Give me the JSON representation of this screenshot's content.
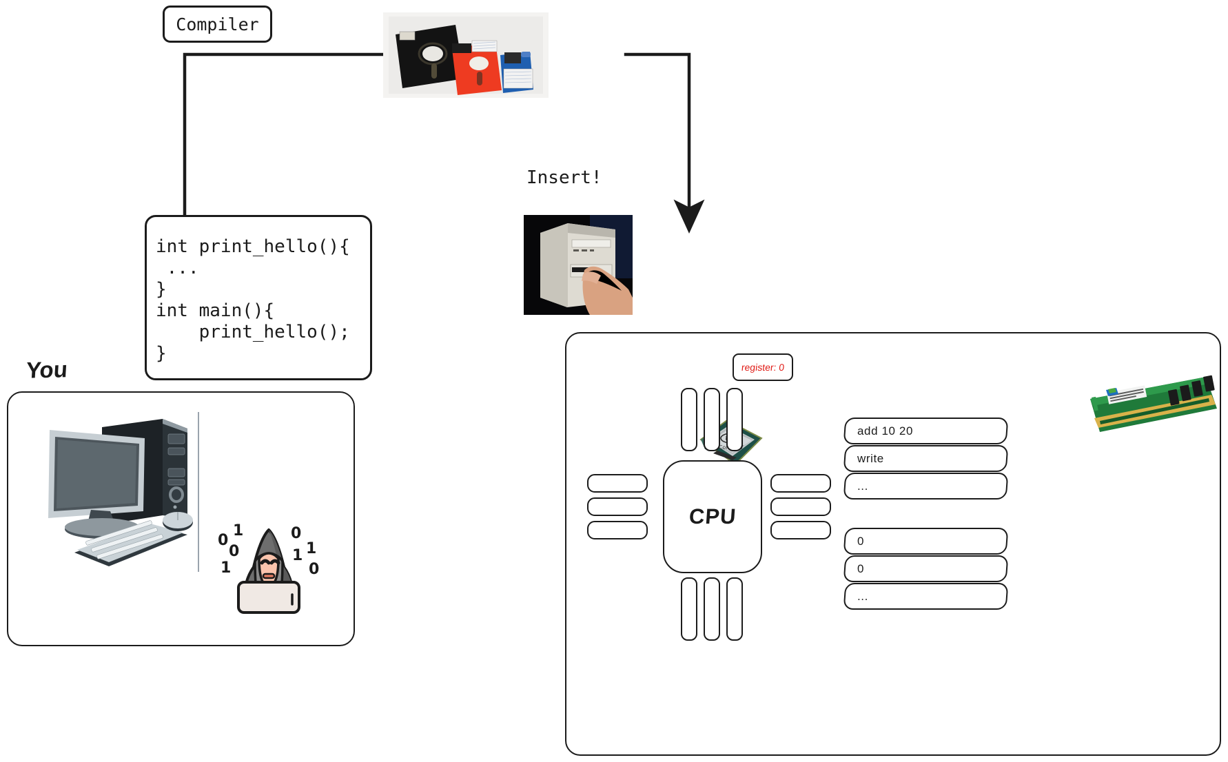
{
  "diagram": {
    "title": "Compiler, floppy disk, computer and CPU diagram",
    "compiler_label": "Compiler",
    "insert_label": "Insert!",
    "you_label": "You",
    "cpu_label": "CPU",
    "register_label": "register: 0",
    "code_lines": [
      "int print_hello(){",
      " ...",
      "}",
      "int main(){",
      "    print_hello();",
      "}"
    ],
    "memory": {
      "instructions": [
        "add 10 20",
        "write",
        "..."
      ],
      "data": [
        "0",
        "0",
        "..."
      ]
    },
    "icons": {
      "floppy_disks": "floppy-disks-photo",
      "tower_insert": "tower-insert-floppy-photo",
      "desktop_pc": "desktop-computer-art",
      "hacker": "hacker-emoji",
      "intel_chip": "intel-core-i7-chip-photo",
      "ram_stick": "ram-dimm-photo"
    },
    "colors": {
      "ink": "#1b1b1b",
      "register_red": "#e01b16",
      "floppy_red": "#ee3b21",
      "floppy_blue": "#1f5fb0",
      "ram_green": "#1f7a3a"
    },
    "hacker_bits": [
      "0",
      "1",
      "0",
      "1",
      "0",
      "1",
      "1",
      "0"
    ]
  }
}
